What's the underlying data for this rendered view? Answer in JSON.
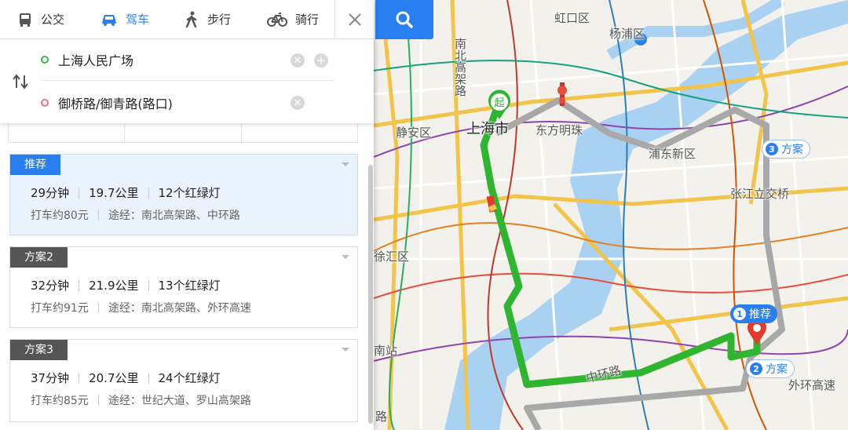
{
  "modes": [
    {
      "label": "公交",
      "icon": "bus-icon",
      "active": false
    },
    {
      "label": "驾车",
      "icon": "car-icon",
      "active": true
    },
    {
      "label": "步行",
      "icon": "walk-icon",
      "active": false
    },
    {
      "label": "骑行",
      "icon": "bike-icon",
      "active": false
    }
  ],
  "route_input": {
    "start": "上海人民广场",
    "end": "御桥路/御青路(路口)"
  },
  "plans": [
    {
      "tag": "推荐",
      "time": "29分钟",
      "distance": "19.7公里",
      "lights": "12个红绿灯",
      "taxi": "打车约80元",
      "via": "途经：南北高架路、中环路",
      "selected": true
    },
    {
      "tag": "方案2",
      "time": "32分钟",
      "distance": "21.9公里",
      "lights": "13个红绿灯",
      "taxi": "打车约91元",
      "via": "途经：南北高架路、外环高速",
      "selected": false
    },
    {
      "tag": "方案3",
      "time": "37分钟",
      "distance": "20.7公里",
      "lights": "24个红绿灯",
      "taxi": "打车约85元",
      "via": "途经：世纪大道、罗山高架路",
      "selected": false
    }
  ],
  "map": {
    "labels": {
      "hongkou": "虹口区",
      "yangpu": "杨浦区",
      "nanbei": "南北高架路",
      "jingan": "静安区",
      "shanghai": "上海市",
      "pearl": "东方明珠",
      "pudong": "浦东新区",
      "zhangjiang": "张江立交桥",
      "xuhui": "徐汇区",
      "nanzhan": "南站",
      "zhonghuan": "中环路",
      "waihuan": "外环高速",
      "lu": "路"
    },
    "start_marker": "起",
    "badges": {
      "rec_num": "1",
      "rec_label": "推荐",
      "p2_num": "2",
      "p2_label": "方案",
      "p3_num": "3",
      "p3_label": "方案"
    },
    "colors": {
      "route": "#2fb52f",
      "accent": "#2a7ff0",
      "alt_route": "#a8a8a8"
    }
  }
}
